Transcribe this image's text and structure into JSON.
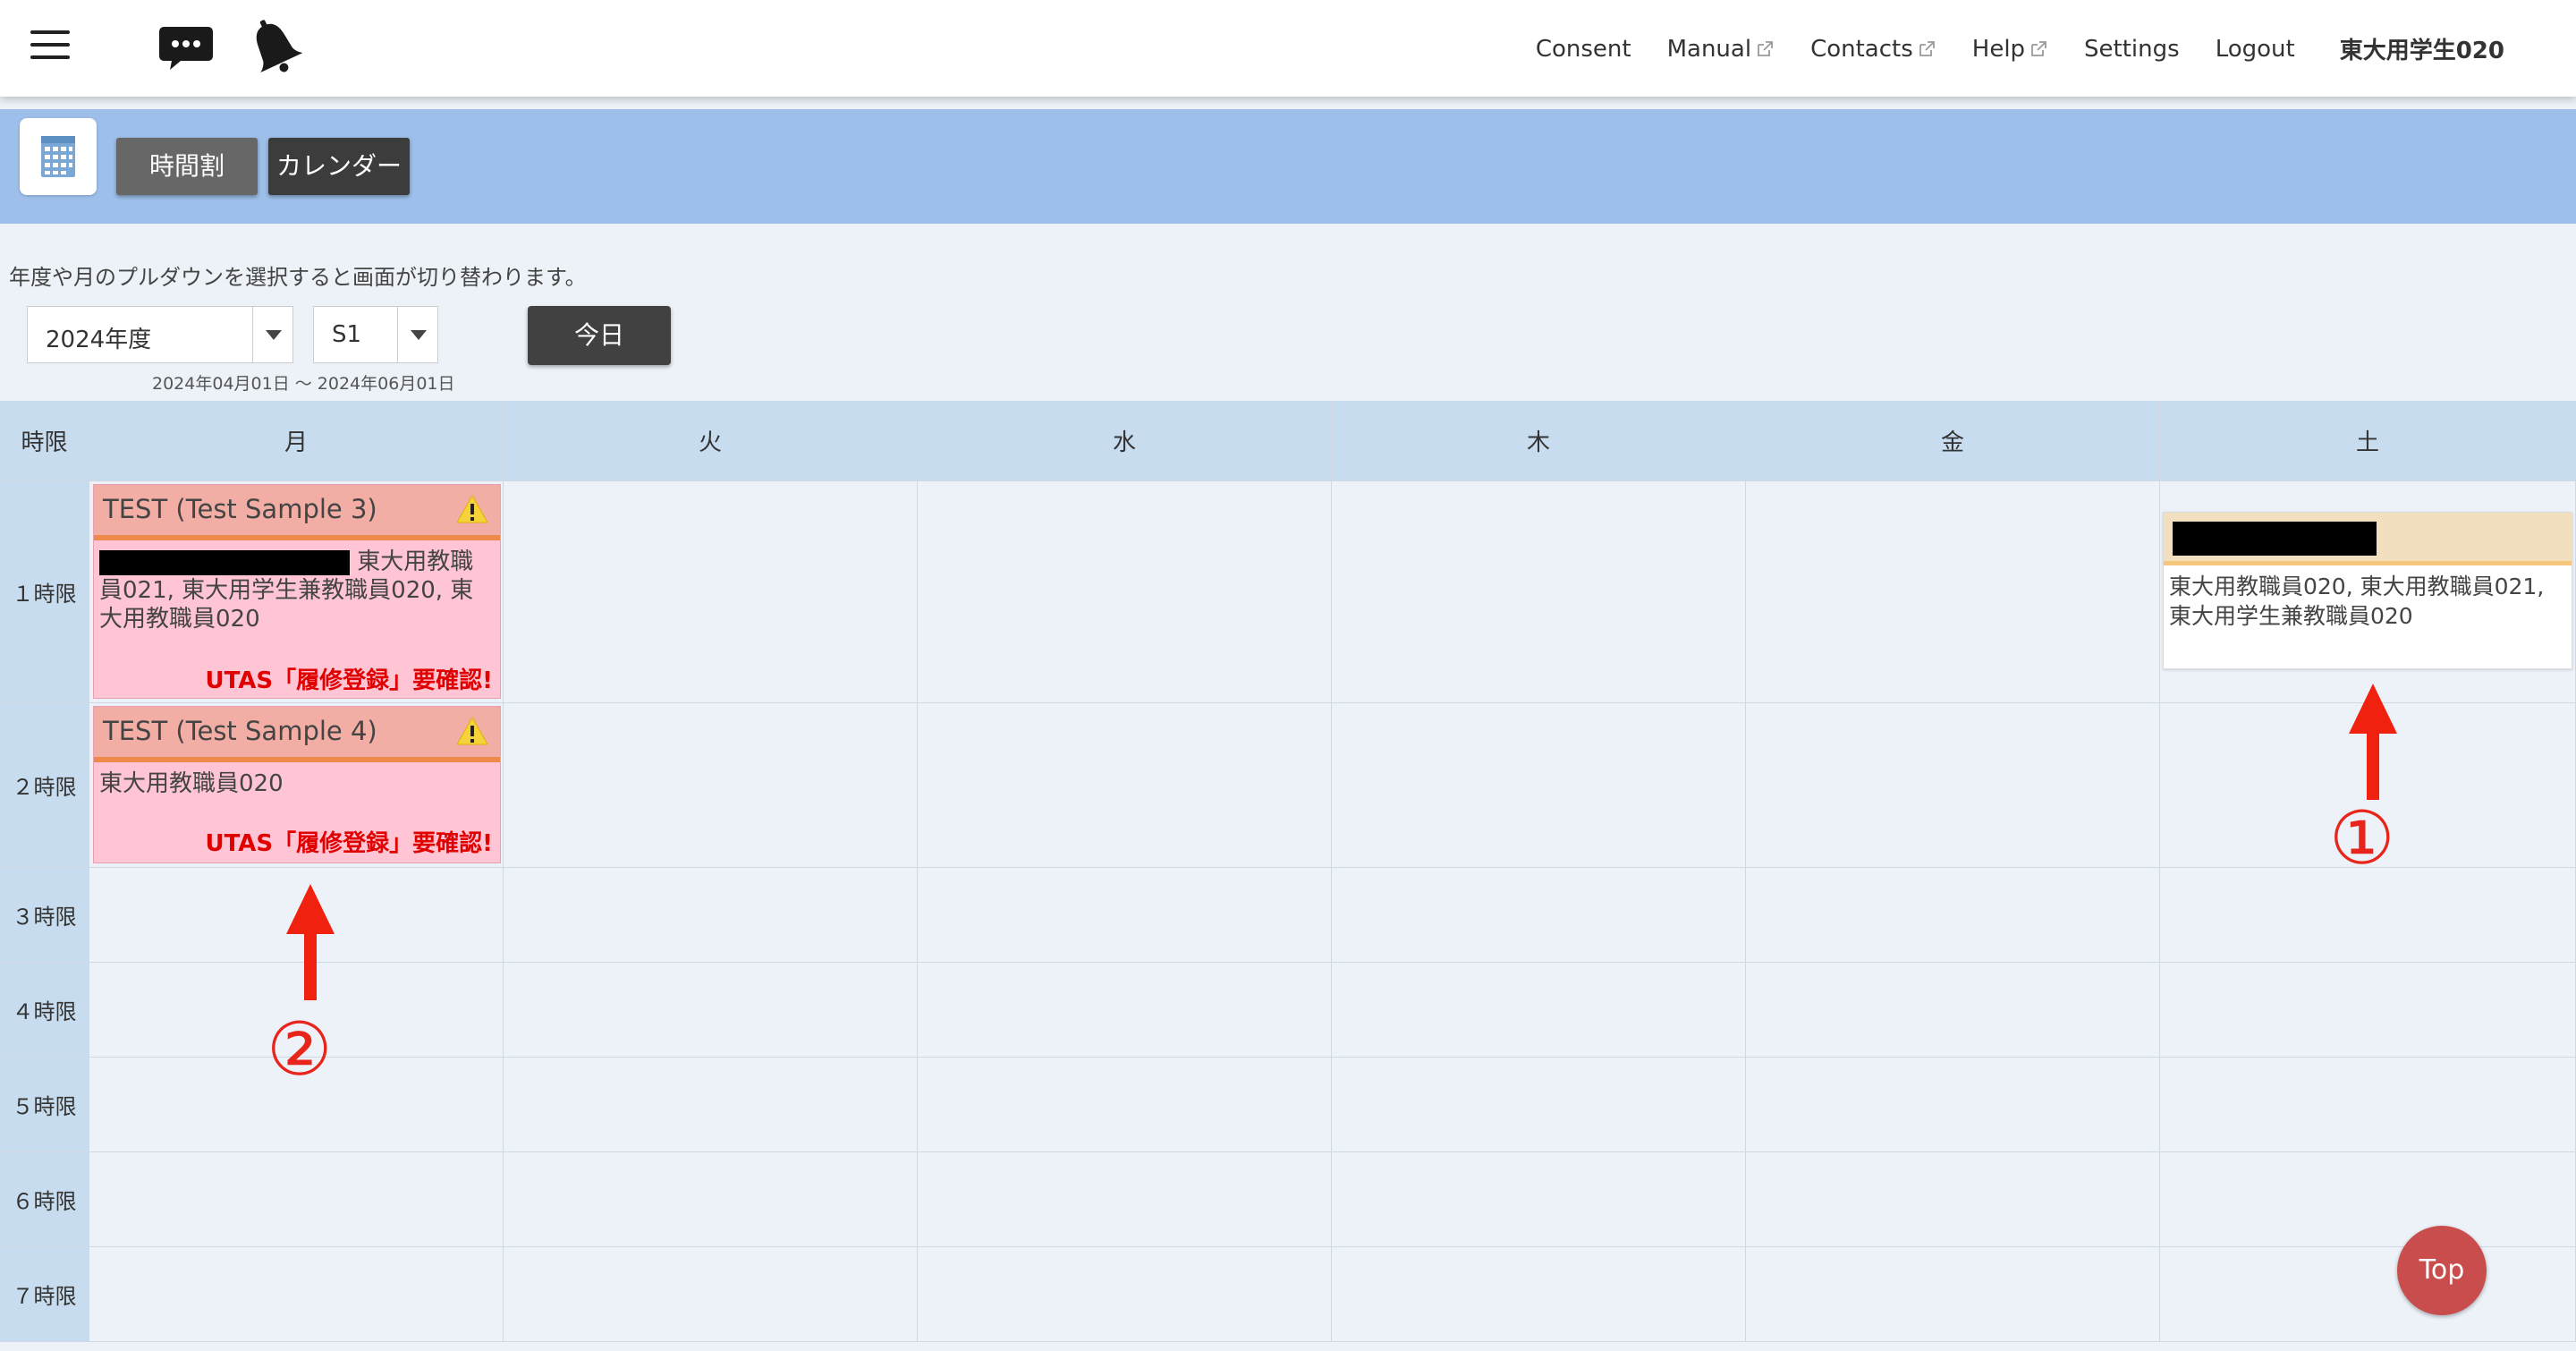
{
  "header": {
    "nav": [
      {
        "label": "Consent",
        "external": false
      },
      {
        "label": "Manual",
        "external": true
      },
      {
        "label": "Contacts",
        "external": true
      },
      {
        "label": "Help",
        "external": true
      },
      {
        "label": "Settings",
        "external": false
      },
      {
        "label": "Logout",
        "external": false
      }
    ],
    "user_name": "東大用学生020",
    "icons": [
      "menu-icon",
      "chat-icon",
      "bell-icon"
    ]
  },
  "tabs": {
    "timetable": "時間割",
    "calendar": "カレンダー"
  },
  "controls": {
    "instruction": "年度や月のプルダウンを選択すると画面が切り替わります。",
    "year_select": "2024年度",
    "term_select": "S1",
    "date_range": "2024年04月01日 〜 2024年06月01日",
    "today_button": "今日"
  },
  "grid": {
    "corner_label": "時限",
    "days": [
      "月",
      "火",
      "水",
      "木",
      "金",
      "土"
    ],
    "periods": [
      "１時限",
      "２時限",
      "３時限",
      "４時限",
      "５時限",
      "６時限",
      "７時限"
    ]
  },
  "courses": {
    "mon1": {
      "title": "TEST (Test Sample 3)",
      "teachers": "東大用教職員021, 東大用学生兼教職員020, 東大用教職員020",
      "teachers_first": "東大用教職",
      "teachers_rest": "員021, 東大用学生兼教職員020, 東\n大用教職員020",
      "notice": "UTAS「履修登録」要確認!"
    },
    "mon2": {
      "title": "TEST (Test Sample 4)",
      "teachers": "東大用教職員020",
      "notice": "UTAS「履修登録」要確認!"
    },
    "sat1": {
      "teachers_line1": "東大用教職員020, 東大用教職員021,",
      "teachers_line2": "東大用学生兼教職員020"
    }
  },
  "annotations": {
    "one": "①",
    "two": "②"
  },
  "top_button": "Top",
  "colors": {
    "band": "#9dbfea",
    "grid_header": "#c7dcee",
    "pink_card": "#ffc5d4",
    "pink_header": "#f2aea4",
    "notice_red": "#e10000",
    "annotation_red": "#e8251b",
    "top_button": "#c94d4d"
  }
}
